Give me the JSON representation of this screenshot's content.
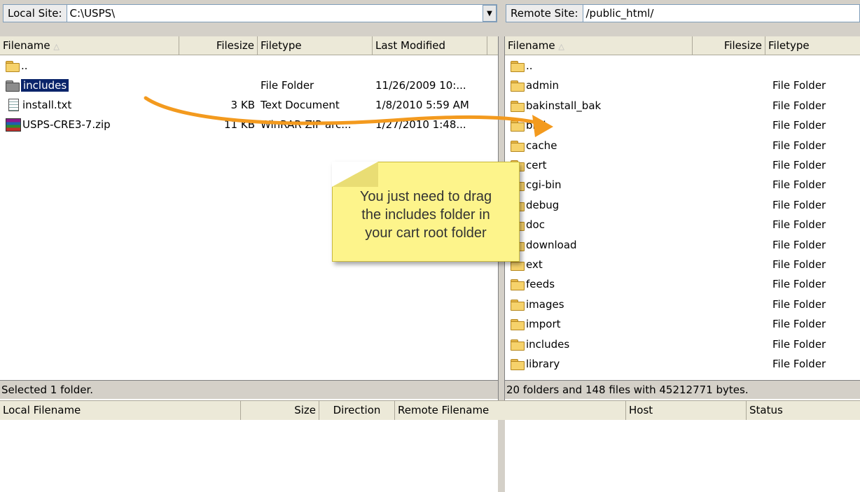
{
  "local": {
    "site_label": "Local Site:",
    "site_path": "C:\\USPS\\",
    "columns": {
      "filename": "Filename",
      "filesize": "Filesize",
      "filetype": "Filetype",
      "modified": "Last Modified"
    },
    "files": [
      {
        "name": "..",
        "size": "",
        "type": "",
        "modified": ""
      },
      {
        "name": "includes",
        "size": "",
        "type": "File Folder",
        "modified": "11/26/2009 10:..."
      },
      {
        "name": "install.txt",
        "size": "3 KB",
        "type": "Text Document",
        "modified": "1/8/2010 5:59 AM"
      },
      {
        "name": "USPS-CRE3-7.zip",
        "size": "11 KB",
        "type": "WinRAR ZIP arc...",
        "modified": "1/27/2010 1:48..."
      }
    ],
    "status": "Selected 1 folder."
  },
  "remote": {
    "site_label": "Remote Site:",
    "site_path": "/public_html/",
    "columns": {
      "filename": "Filename",
      "filesize": "Filesize",
      "filetype": "Filetype"
    },
    "files": [
      {
        "name": "..",
        "type": ""
      },
      {
        "name": "admin",
        "type": "File Folder"
      },
      {
        "name": "bakinstall_bak",
        "type": "File Folder"
      },
      {
        "name": "bnd",
        "type": "File Folder"
      },
      {
        "name": "cache",
        "type": "File Folder"
      },
      {
        "name": "cert",
        "type": "File Folder"
      },
      {
        "name": "cgi-bin",
        "type": "File Folder"
      },
      {
        "name": "debug",
        "type": "File Folder"
      },
      {
        "name": "doc",
        "type": "File Folder"
      },
      {
        "name": "download",
        "type": "File Folder"
      },
      {
        "name": "ext",
        "type": "File Folder"
      },
      {
        "name": "feeds",
        "type": "File Folder"
      },
      {
        "name": "images",
        "type": "File Folder"
      },
      {
        "name": "import",
        "type": "File Folder"
      },
      {
        "name": "includes",
        "type": "File Folder"
      },
      {
        "name": "library",
        "type": "File Folder"
      }
    ],
    "status": "20 folders and 148 files with 45212771 bytes."
  },
  "queue": {
    "columns": [
      "Local Filename",
      "Size",
      "Direction",
      "Remote Filename",
      "Host",
      "Status"
    ]
  },
  "callout": {
    "line1": "You just need to drag",
    "line2": "the includes folder in",
    "line3": "your cart root folder"
  },
  "colors": {
    "arrow": "#f39a1e",
    "note": "#fdf48b",
    "selection": "#0a246a"
  }
}
